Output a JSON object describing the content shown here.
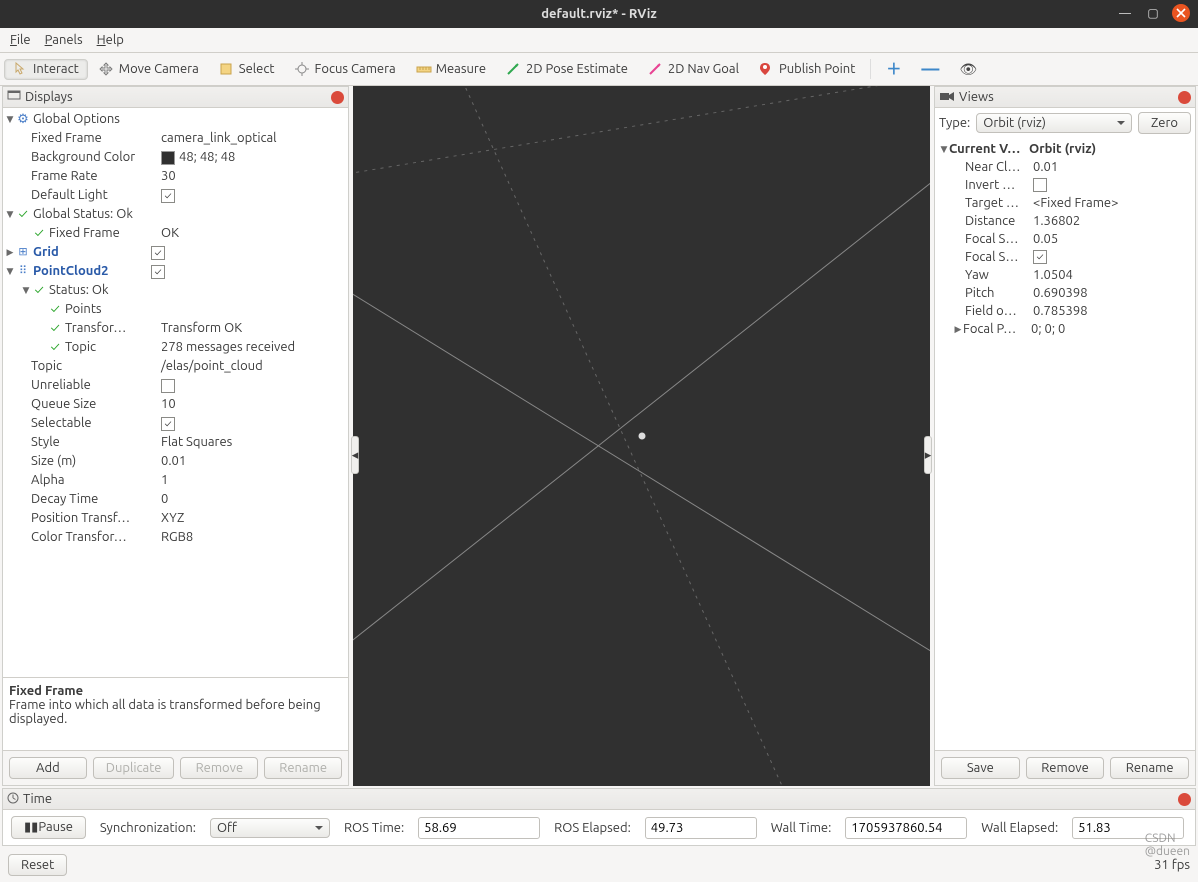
{
  "window": {
    "title": "default.rviz* - RViz"
  },
  "menubar": {
    "file": "File",
    "panels": "Panels",
    "help": "Help"
  },
  "toolbar": {
    "interact": "Interact",
    "move_camera": "Move Camera",
    "select": "Select",
    "focus_camera": "Focus Camera",
    "measure": "Measure",
    "pose_estimate": "2D Pose Estimate",
    "nav_goal": "2D Nav Goal",
    "publish_point": "Publish Point"
  },
  "displays": {
    "title": "Displays",
    "global_options": {
      "label": "Global Options",
      "fixed_frame": {
        "l": "Fixed Frame",
        "v": "camera_link_optical"
      },
      "bg": {
        "l": "Background Color",
        "v": "48; 48; 48"
      },
      "fr": {
        "l": "Frame Rate",
        "v": "30"
      },
      "dl": {
        "l": "Default Light",
        "v": "on"
      }
    },
    "global_status": {
      "label": "Global Status: Ok",
      "ff": {
        "l": "Fixed Frame",
        "v": "OK"
      }
    },
    "grid": {
      "label": "Grid"
    },
    "pc": {
      "label": "PointCloud2",
      "status": {
        "l": "Status: Ok"
      },
      "points": {
        "l": "Points"
      },
      "transform": {
        "l": "Transfor…",
        "v": "Transform OK"
      },
      "topic_status": {
        "l": "Topic",
        "v": "278 messages received"
      },
      "topic": {
        "l": "Topic",
        "v": "/elas/point_cloud"
      },
      "unreliable": {
        "l": "Unreliable"
      },
      "queue": {
        "l": "Queue Size",
        "v": "10"
      },
      "selectable": {
        "l": "Selectable"
      },
      "style": {
        "l": "Style",
        "v": "Flat Squares"
      },
      "size": {
        "l": "Size (m)",
        "v": "0.01"
      },
      "alpha": {
        "l": "Alpha",
        "v": "1"
      },
      "decay": {
        "l": "Decay Time",
        "v": "0"
      },
      "pos_t": {
        "l": "Position Transf…",
        "v": "XYZ"
      },
      "col_t": {
        "l": "Color Transfor…",
        "v": "RGB8"
      }
    },
    "desc": {
      "title": "Fixed Frame",
      "body": "Frame into which all data is transformed before being displayed."
    },
    "buttons": {
      "add": "Add",
      "duplicate": "Duplicate",
      "remove": "Remove",
      "rename": "Rename"
    }
  },
  "views": {
    "title": "Views",
    "type_label": "Type:",
    "type_value": "Orbit (rviz)",
    "zero": "Zero",
    "current": {
      "l": "Current V…",
      "v": "Orbit (rviz)"
    },
    "near": {
      "l": "Near Cl…",
      "v": "0.01"
    },
    "invert": {
      "l": "Invert …"
    },
    "target": {
      "l": "Target …",
      "v": "<Fixed Frame>"
    },
    "distance": {
      "l": "Distance",
      "v": "1.36802"
    },
    "focal_s1": {
      "l": "Focal S…",
      "v": "0.05"
    },
    "focal_s2": {
      "l": "Focal S…"
    },
    "yaw": {
      "l": "Yaw",
      "v": "1.0504"
    },
    "pitch": {
      "l": "Pitch",
      "v": "0.690398"
    },
    "fov": {
      "l": "Field o…",
      "v": "0.785398"
    },
    "focal_p": {
      "l": "Focal P…",
      "v": "0; 0; 0"
    },
    "buttons": {
      "save": "Save",
      "remove": "Remove",
      "rename": "Rename"
    }
  },
  "time": {
    "title": "Time",
    "pause": "Pause",
    "sync_l": "Synchronization:",
    "sync_v": "Off",
    "ros_time_l": "ROS Time:",
    "ros_time_v": "58.69",
    "ros_elapsed_l": "ROS Elapsed:",
    "ros_elapsed_v": "49.73",
    "wall_time_l": "Wall Time:",
    "wall_time_v": "1705937860.54",
    "wall_elapsed_l": "Wall Elapsed:",
    "wall_elapsed_v": "51.83"
  },
  "footer": {
    "reset": "Reset",
    "fps": "31 fps",
    "watermark": "CSDN @dueen"
  }
}
